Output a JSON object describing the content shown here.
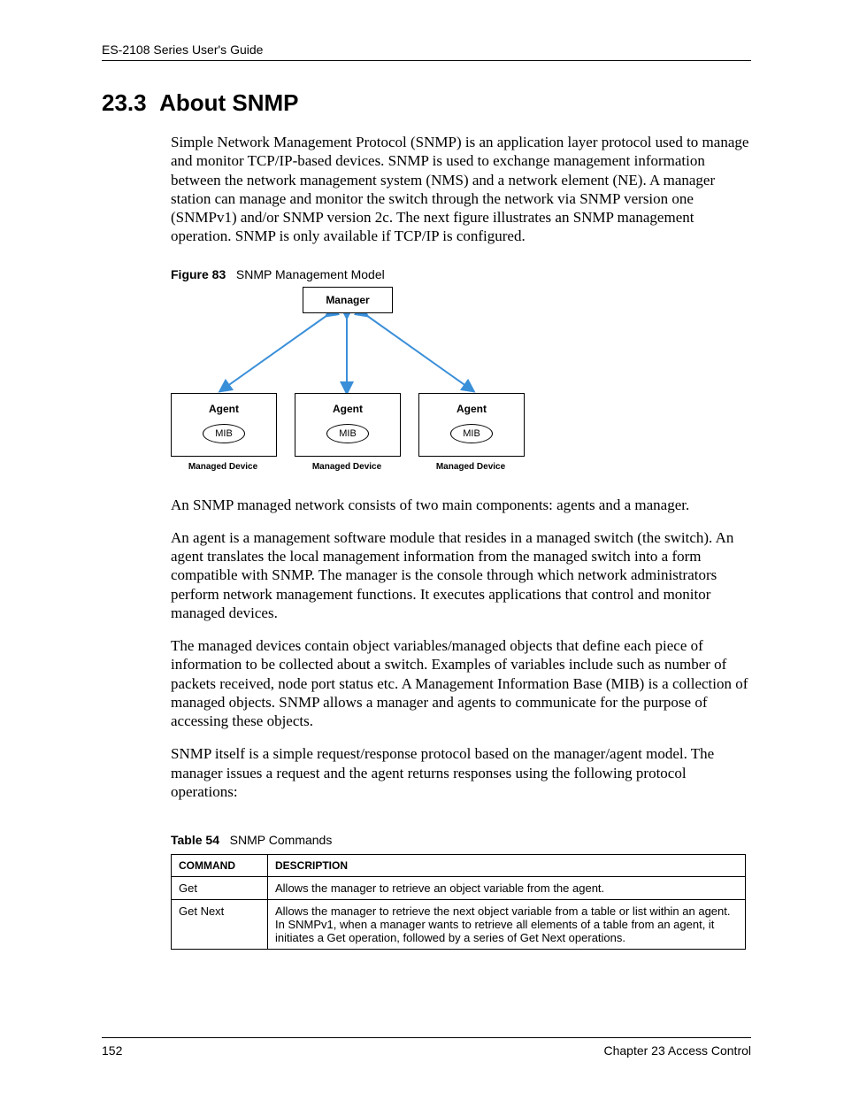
{
  "header": {
    "running_title": "ES-2108 Series User's Guide"
  },
  "section": {
    "number": "23.3",
    "title": "About SNMP"
  },
  "paras": {
    "p1": "Simple Network Management Protocol (SNMP) is an application layer protocol used to manage and monitor TCP/IP-based devices.  SNMP is used to exchange management information between the network management system (NMS) and a network element (NE). A manager station can manage and monitor the switch through the network via SNMP version one (SNMPv1) and/or SNMP version 2c. The next figure illustrates an SNMP management operation. SNMP is only available if TCP/IP is configured.",
    "p2": "An SNMP managed network consists of two main components: agents and a manager.",
    "p3": "An agent is a management software module that resides in a managed switch (the switch). An agent translates the local management information from the managed switch into a form compatible with SNMP. The manager is the console through which network administrators perform network management functions. It executes applications that control and monitor managed devices.",
    "p4": "The managed devices contain object variables/managed objects that define each piece of information to be collected about a switch. Examples of variables include such as number of packets received, node port status etc. A Management Information Base (MIB) is a collection of managed objects.  SNMP allows a manager and agents to communicate for the purpose of accessing these objects.",
    "p5": "SNMP itself is a simple request/response protocol based on the manager/agent model. The manager issues a request and the agent returns responses using the following protocol operations:"
  },
  "figure": {
    "label_prefix": "Figure 83",
    "caption": "SNMP Management Model",
    "manager": "Manager",
    "agent": "Agent",
    "mib": "MIB",
    "managed_device": "Managed Device"
  },
  "table": {
    "label_prefix": "Table 54",
    "caption": "SNMP Commands",
    "headers": {
      "cmd": "COMMAND",
      "desc": "DESCRIPTION"
    },
    "rows": [
      {
        "cmd": "Get",
        "desc": "Allows the manager to retrieve an object variable from the agent."
      },
      {
        "cmd": "Get Next",
        "desc": "Allows the manager to retrieve the next object variable from a table or list within an agent. In SNMPv1, when a manager wants to retrieve all elements of a table from an agent, it initiates a Get operation, followed by a series of Get Next operations."
      }
    ]
  },
  "footer": {
    "page": "152",
    "chapter": "Chapter 23 Access Control"
  }
}
